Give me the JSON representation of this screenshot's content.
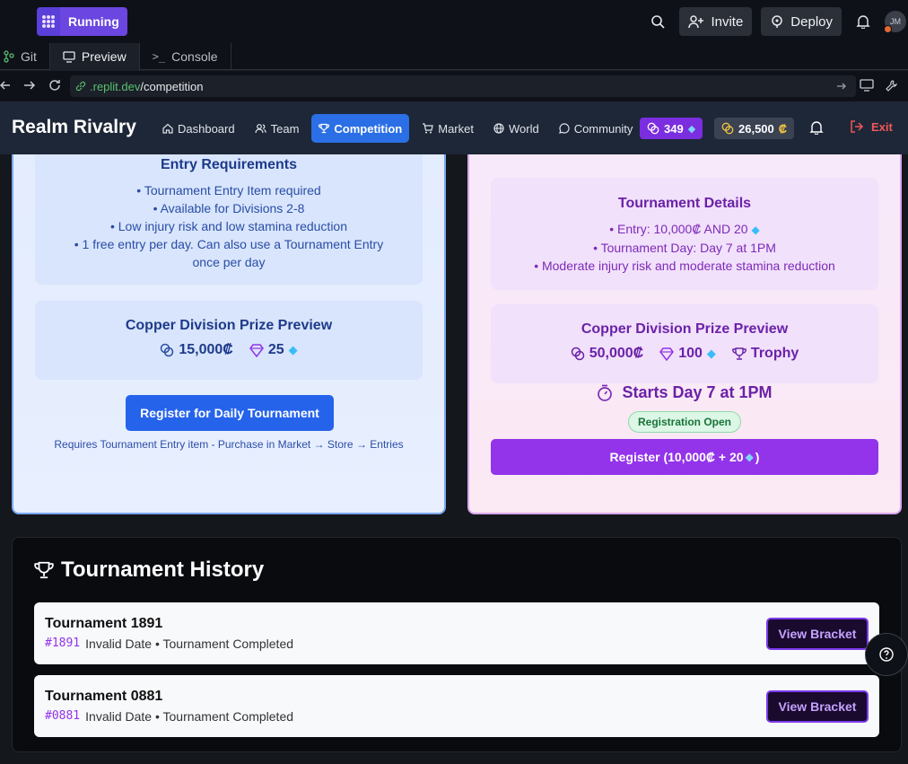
{
  "ide": {
    "run_label": "Running",
    "invite_label": "Invite",
    "deploy_label": "Deploy",
    "avatar_initials": "JM",
    "tabs": [
      {
        "label": "Git"
      },
      {
        "label": "Preview"
      },
      {
        "label": "Console"
      }
    ],
    "url_host": ".replit.dev",
    "url_path": "/competition"
  },
  "app": {
    "brand": "Realm Rivalry",
    "nav": [
      {
        "label": "Dashboard"
      },
      {
        "label": "Team"
      },
      {
        "label": "Competition"
      },
      {
        "label": "Market"
      },
      {
        "label": "World"
      },
      {
        "label": "Community"
      }
    ],
    "gems": "349",
    "credits": "26,500",
    "exit_label": "Exit"
  },
  "daily": {
    "req_title": "Entry Requirements",
    "req_lines": [
      "• Tournament Entry Item required",
      "• Available for Divisions 2-8",
      "• Low injury risk and low stamina reduction",
      "• 1 free entry per day. Can also use a Tournament Entry once per day"
    ],
    "prize_title": "Copper Division Prize Preview",
    "prize_credits": "15,000₡",
    "prize_gems": "25",
    "register_label": "Register for Daily Tournament",
    "note": "Requires Tournament Entry item - Purchase in Market → Store → Entries"
  },
  "major": {
    "details_title": "Tournament Details",
    "detail_lines": [
      "• Entry: 10,000₡ AND 20",
      "• Tournament Day: Day 7 at 1PM",
      "• Moderate injury risk and moderate stamina reduction"
    ],
    "prize_title": "Copper Division Prize Preview",
    "prize_credits": "50,000₡",
    "prize_gems": "100",
    "prize_trophy": "Trophy",
    "starts": "Starts Day 7 at 1PM",
    "status": "Registration Open",
    "register_prefix": "Register (10,000₡ + 20",
    "register_suffix": ")"
  },
  "history": {
    "title": "Tournament History",
    "rows": [
      {
        "name": "Tournament 1891",
        "id": "#1891",
        "meta": "Invalid Date • Tournament Completed",
        "button": "View Bracket"
      },
      {
        "name": "Tournament 0881",
        "id": "#0881",
        "meta": "Invalid Date • Tournament Completed",
        "button": "View Bracket"
      }
    ]
  }
}
